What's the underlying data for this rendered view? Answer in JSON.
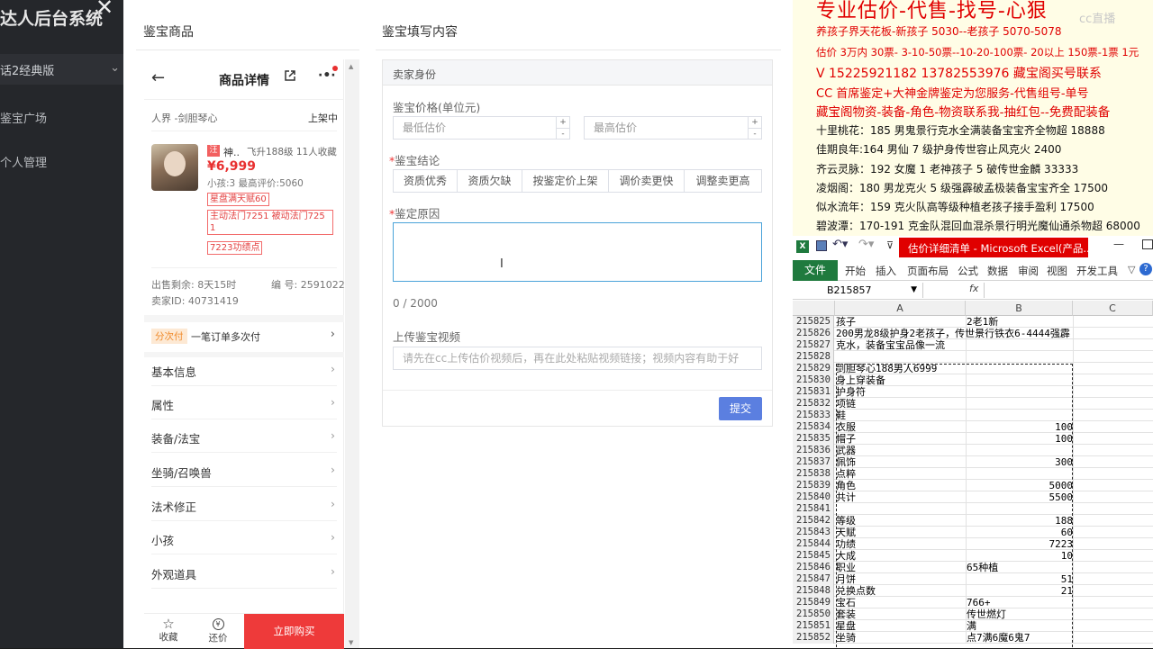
{
  "backdrop": {
    "app_title": "达人后台系统",
    "version_select": "话2经典版",
    "nav": [
      "鉴宝广场",
      "个人管理"
    ],
    "close_icon": "close-icon"
  },
  "modal": {
    "left_title": "鉴宝商品",
    "right_title": "鉴宝填写内容"
  },
  "phone": {
    "header_title": "商品详情",
    "realm": "人界 -剑胆琴心",
    "status": "上架中",
    "item_name": "神..",
    "item_meta": "飞升188级 11人收藏",
    "price": "¥6,999",
    "small_info": "小孩:3 最高评价:5060",
    "tags": [
      "星盘满天赋60",
      "主动法门7251 被动法门7251",
      "7223功绩点"
    ],
    "time_left": "出售剩余: 8天15时",
    "item_no": "编 号: 2591022",
    "seller_id": "卖家ID: 40731419",
    "installment_badge": "分次付",
    "installment_text": "一笔订单多次付",
    "sections": [
      "基本信息",
      "属性",
      "装备/法宝",
      "坐骑/召唤兽",
      "法术修正",
      "小孩",
      "外观道具"
    ],
    "footer": {
      "fav": "收藏",
      "bargain": "还价",
      "buy": "立即购买"
    }
  },
  "form": {
    "section_header": "卖家身份",
    "price_label": "鉴宝价格(单位元)",
    "min_placeholder": "最低估价",
    "max_placeholder": "最高估价",
    "conclusion_label": "鉴宝结论",
    "conclusion_options": [
      "资质优秀",
      "资质欠缺",
      "按鉴定价上架",
      "调价卖更快",
      "调整卖更高"
    ],
    "reason_label": "鉴定原因",
    "reason_counter": "0 / 2000",
    "video_label": "上传鉴宝视频",
    "video_placeholder": "请先在cc上传估价视频后，再在此处粘贴视频链接；视频内容有助于好",
    "submit": "提交"
  },
  "ad": {
    "headline": "专业估价-代售-找号-心狠",
    "watermark": "cc直播",
    "lines": [
      {
        "text": "养孩子界天花板-新孩子 5030--老孩子 5070-5078",
        "color": "#e00000"
      },
      {
        "text": "估价 3万内 30票- 3-10-50票--10-20-100票- 20以上 150票-1票 1元",
        "color": "#e00000"
      },
      {
        "text": "V 15225921182    13782553976   藏宝阁买号联系",
        "color": "#e00000"
      },
      {
        "text": "CC 首席鉴定+大神金牌鉴定为您服务-代售组号-单号",
        "color": "#e00000"
      },
      {
        "text": "藏宝阁物资-装备-角色-物资联系我-抽红包--免费配装备",
        "color": "#e00000"
      },
      {
        "text": "十里桃花：185 男鬼景行克水全满装备宝宝齐全物超 18888",
        "color": "#111111"
      },
      {
        "text": "佳期良年:164 男仙 7 级护身传世容止风克火 2400",
        "color": "#111111"
      },
      {
        "text": "齐云灵脉：192 女魔 1 老神孩子 5 破传世金麟 33333",
        "color": "#111111"
      },
      {
        "text": "凌烟阁：180 男龙克火 5 级强霹破孟极装备宝宝齐全 17500",
        "color": "#111111"
      },
      {
        "text": "似水流年：159 克火队高等级种植老孩子接手盈利 17500",
        "color": "#111111"
      },
      {
        "text": "碧波潭：170-191 克金队混回血混杀景行明光魔仙通杀物超 68000",
        "color": "#111111"
      }
    ]
  },
  "excel": {
    "title": "估价详细清单 - Microsoft Excel(产品...",
    "tabs": [
      "文件",
      "开始",
      "插入",
      "页面布局",
      "公式",
      "数据",
      "审阅",
      "视图",
      "开发工具"
    ],
    "name_box": "B215857",
    "fx": "fx",
    "columns": [
      "A",
      "B",
      "C"
    ],
    "rows": [
      {
        "n": "215825",
        "a": "孩子",
        "b": "2老1新",
        "num": false
      },
      {
        "n": "215826",
        "a": "200男龙8级护身2老孩子，传世景行铁衣6-4444强霹",
        "b": "",
        "num": false
      },
      {
        "n": "215827",
        "a": "克水，装备宝宝品像一流",
        "b": "",
        "num": false
      },
      {
        "n": "215828",
        "a": "",
        "b": "",
        "num": false
      },
      {
        "n": "215829",
        "a": "剑胆琴心188男人6999",
        "b": "",
        "num": false
      },
      {
        "n": "215830",
        "a": "身上穿装备",
        "b": "",
        "num": false
      },
      {
        "n": "215831",
        "a": "护身符",
        "b": "",
        "num": false
      },
      {
        "n": "215832",
        "a": "项链",
        "b": "",
        "num": false
      },
      {
        "n": "215833",
        "a": "鞋",
        "b": "",
        "num": false
      },
      {
        "n": "215834",
        "a": "衣服",
        "b": "100",
        "num": true
      },
      {
        "n": "215835",
        "a": "帽子",
        "b": "100",
        "num": true
      },
      {
        "n": "215836",
        "a": "武器",
        "b": "",
        "num": false
      },
      {
        "n": "215837",
        "a": "佩饰",
        "b": "300",
        "num": true
      },
      {
        "n": "215838",
        "a": "点粹",
        "b": "",
        "num": false
      },
      {
        "n": "215839",
        "a": "角色",
        "b": "5000",
        "num": true
      },
      {
        "n": "215840",
        "a": "共计",
        "b": "5500",
        "num": true
      },
      {
        "n": "215841",
        "a": "",
        "b": "",
        "num": false
      },
      {
        "n": "215842",
        "a": "等级",
        "b": "188",
        "num": true
      },
      {
        "n": "215843",
        "a": "天赋",
        "b": "60",
        "num": true
      },
      {
        "n": "215844",
        "a": "功绩",
        "b": "7223",
        "num": true
      },
      {
        "n": "215845",
        "a": "大成",
        "b": "10",
        "num": true
      },
      {
        "n": "215846",
        "a": "职业",
        "b": "65种植",
        "num": false
      },
      {
        "n": "215847",
        "a": "月饼",
        "b": "51",
        "num": true
      },
      {
        "n": "215848",
        "a": "兑换点数",
        "b": "21",
        "num": true
      },
      {
        "n": "215849",
        "a": "宝石",
        "b": "766+",
        "num": false
      },
      {
        "n": "215850",
        "a": "套装",
        "b": "传世燃灯",
        "num": false
      },
      {
        "n": "215851",
        "a": "星盘",
        "b": "满",
        "num": false
      },
      {
        "n": "215852",
        "a": "坐骑",
        "b": "点7满6魔6鬼7",
        "num": false
      }
    ]
  }
}
